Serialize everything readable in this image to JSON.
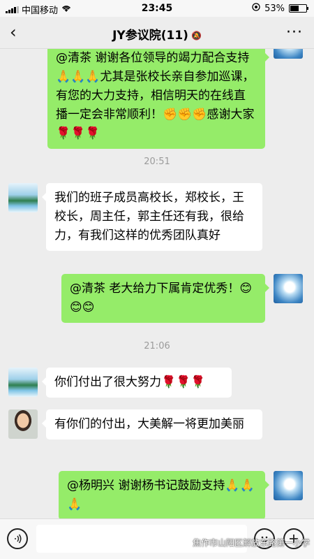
{
  "status_bar": {
    "carrier": "中国移动",
    "wifi_icon": "wifi-icon",
    "time": "23:45",
    "location_icon": "location-icon",
    "battery_percent": "53%",
    "battery_level": 0.53
  },
  "nav": {
    "back_icon": "‹",
    "title": "JY参议院(11)",
    "mute_icon": "🔕",
    "more_icon": "···"
  },
  "messages": {
    "m1": {
      "text": "@清茶 谢谢各位领导的竭力配合支持🙏🙏🙏尤其是张校长亲自参加巡课，有您的大力支持，相信明天的在线直播一定会非常顺利！✊✊✊感谢大家🌹🌹🌹"
    },
    "t1": {
      "time": "20:51"
    },
    "m2": {
      "text": "我们的班子成员高校长，郑校长，王校长，周主任，郭主任还有我，很给力，有我们这样的优秀团队真好"
    },
    "m3": {
      "text": "@清茶 老大给力下属肯定优秀！😊😊😊"
    },
    "t2": {
      "time": "21:06"
    },
    "m4": {
      "text": "你们付出了很大努力🌹🌹🌹"
    },
    "m5": {
      "text": "有你们的付出，大美解一将更加美丽"
    },
    "m6": {
      "text": "@杨明兴 谢谢杨书记鼓励支持🙏🙏🙏"
    }
  },
  "input_bar": {
    "voice_icon": "voice-icon",
    "placeholder": "",
    "emoji_icon": "emoji-icon",
    "plus_icon": "plus-icon"
  },
  "watermark": {
    "text": "焦作市山阳区解放东路第一小学"
  },
  "colors": {
    "outgoing_bubble": "#95ec69",
    "incoming_bubble": "#ffffff",
    "chat_background": "#ededed"
  }
}
